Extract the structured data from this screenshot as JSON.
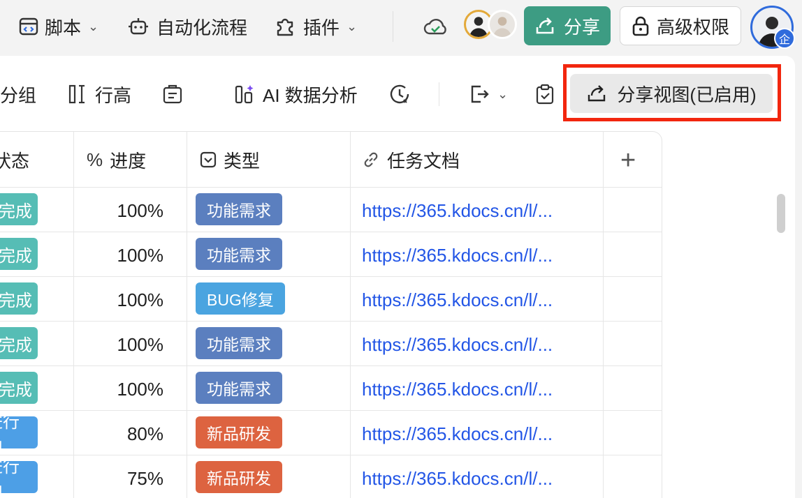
{
  "topbar": {
    "script": "脚本",
    "automation": "自动化流程",
    "plugins": "插件",
    "share": "分享",
    "permissions": "高级权限",
    "me_badge": "企"
  },
  "toolbar": {
    "group": "分组",
    "row_height": "行高",
    "ai": "AI 数据分析",
    "share_view": "分享视图(已启用)"
  },
  "grid": {
    "columns": [
      {
        "label": "状态",
        "icon": "status-icon"
      },
      {
        "label": "进度",
        "icon": "percent-icon"
      },
      {
        "label": "类型",
        "icon": "select-icon"
      },
      {
        "label": "任务文档",
        "icon": "link-icon"
      }
    ],
    "rows": [
      {
        "status": "完成",
        "status_color": "#56bdb5",
        "progress": "100%",
        "type": "功能需求",
        "type_color": "#5b7fbf",
        "doc": "https://365.kdocs.cn/l/..."
      },
      {
        "status": "完成",
        "status_color": "#56bdb5",
        "progress": "100%",
        "type": "功能需求",
        "type_color": "#5b7fbf",
        "doc": "https://365.kdocs.cn/l/..."
      },
      {
        "status": "完成",
        "status_color": "#56bdb5",
        "progress": "100%",
        "type": "BUG修复",
        "type_color": "#4aa4e0",
        "doc": "https://365.kdocs.cn/l/..."
      },
      {
        "status": "完成",
        "status_color": "#56bdb5",
        "progress": "100%",
        "type": "功能需求",
        "type_color": "#5b7fbf",
        "doc": "https://365.kdocs.cn/l/..."
      },
      {
        "status": "完成",
        "status_color": "#56bdb5",
        "progress": "100%",
        "type": "功能需求",
        "type_color": "#5b7fbf",
        "doc": "https://365.kdocs.cn/l/..."
      },
      {
        "status": "进行中",
        "status_color": "#4d9fe6",
        "progress": "80%",
        "type": "新品研发",
        "type_color": "#dd6340",
        "doc": "https://365.kdocs.cn/l/..."
      },
      {
        "status": "进行中",
        "status_color": "#4d9fe6",
        "progress": "75%",
        "type": "新品研发",
        "type_color": "#dd6340",
        "doc": "https://365.kdocs.cn/l/..."
      }
    ]
  },
  "colors": {
    "share_button": "#3d9c83",
    "highlight_box": "#f2260e",
    "link": "#2356e6"
  }
}
